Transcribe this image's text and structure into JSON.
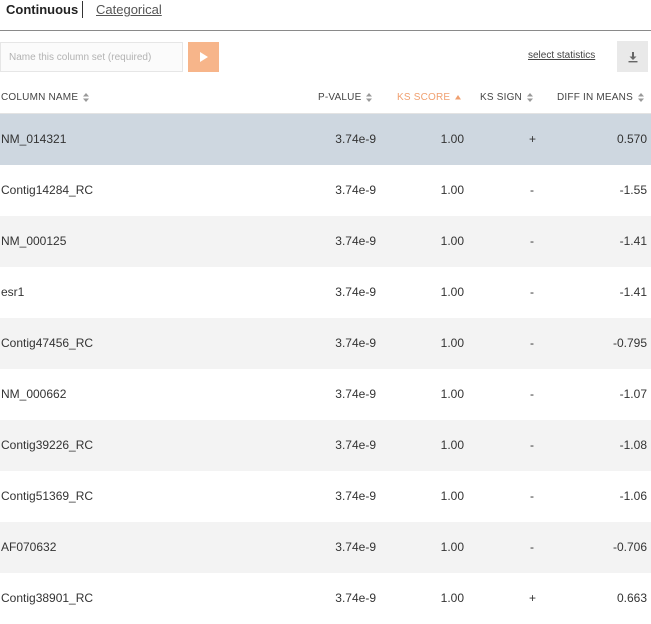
{
  "tabs": [
    {
      "label": "Continuous"
    },
    {
      "label": "Categorical"
    }
  ],
  "toolbar": {
    "name_placeholder": "Name this column set (required)",
    "select_statistics_label": "select statistics"
  },
  "colors": {
    "accent": "#f7b58a",
    "active_header": "#f0a070",
    "selected_row": "#ced7e0"
  },
  "table": {
    "columns": {
      "name": "COLUMN NAME",
      "p_value": "P-VALUE",
      "ks_score": "KS SCORE",
      "ks_sign": "KS SIGN",
      "diff_in_means": "DIFF IN MEANS"
    },
    "sorted_by": "ks_score",
    "rows": [
      {
        "name": "NM_014321",
        "p_value": "3.74e-9",
        "ks_score": "1.00",
        "ks_sign": "+",
        "diff": "0.570"
      },
      {
        "name": "Contig14284_RC",
        "p_value": "3.74e-9",
        "ks_score": "1.00",
        "ks_sign": "-",
        "diff": "-1.55"
      },
      {
        "name": "NM_000125",
        "p_value": "3.74e-9",
        "ks_score": "1.00",
        "ks_sign": "-",
        "diff": "-1.41"
      },
      {
        "name": "esr1",
        "p_value": "3.74e-9",
        "ks_score": "1.00",
        "ks_sign": "-",
        "diff": "-1.41"
      },
      {
        "name": "Contig47456_RC",
        "p_value": "3.74e-9",
        "ks_score": "1.00",
        "ks_sign": "-",
        "diff": "-0.795"
      },
      {
        "name": "NM_000662",
        "p_value": "3.74e-9",
        "ks_score": "1.00",
        "ks_sign": "-",
        "diff": "-1.07"
      },
      {
        "name": "Contig39226_RC",
        "p_value": "3.74e-9",
        "ks_score": "1.00",
        "ks_sign": "-",
        "diff": "-1.08"
      },
      {
        "name": "Contig51369_RC",
        "p_value": "3.74e-9",
        "ks_score": "1.00",
        "ks_sign": "-",
        "diff": "-1.06"
      },
      {
        "name": "AF070632",
        "p_value": "3.74e-9",
        "ks_score": "1.00",
        "ks_sign": "-",
        "diff": "-0.706"
      },
      {
        "name": "Contig38901_RC",
        "p_value": "3.74e-9",
        "ks_score": "1.00",
        "ks_sign": "+",
        "diff": "0.663"
      }
    ]
  }
}
